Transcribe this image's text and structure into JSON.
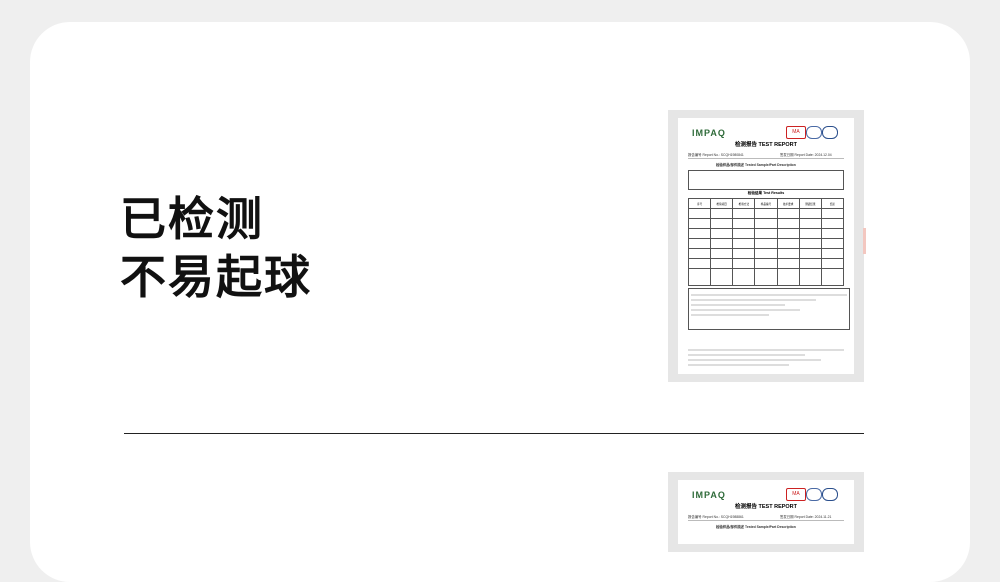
{
  "headline": {
    "line1": "已检测",
    "line2": "不易起球"
  },
  "report": {
    "logo": "IMPAQ",
    "cert_ma": "MA",
    "cert_ilac": "ilac-MRA",
    "cert_cnas": "CNAS",
    "title": "检测报告 TEST REPORT",
    "report_no_1": "报告编号 Report No.: SCQH1980841",
    "report_date_1": "签发日期 Report Date: 2024.12.04",
    "report_no_2": "报告编号 Report No.: SCQH1988861",
    "report_date_2": "签发日期 Report Date: 2024.11.21",
    "sample_title": "检验样品/部件描述 Tested Sample/Part Description",
    "results_title": "检验结果 Test Results",
    "columns": [
      "序号",
      "检验项目",
      "检验方法",
      "样品编号",
      "技术要求",
      "测试结果",
      "结论"
    ]
  },
  "colors": {
    "logo": "#2f6b3a",
    "cert_ma": "#cc2222",
    "background": "#efefef"
  }
}
